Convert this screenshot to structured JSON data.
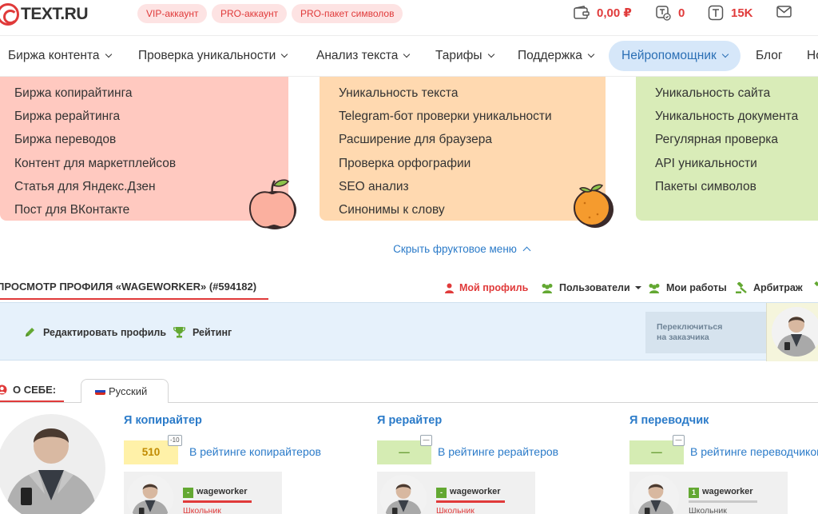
{
  "header": {
    "logo_text": "TEXT.RU",
    "pills": [
      "VIP-аккаунт",
      "PRO-аккаунт",
      "PRO-пакет символов"
    ],
    "balance": "0,00 ₽",
    "tasks_count": "0",
    "symbols": "15K"
  },
  "nav": {
    "items": [
      {
        "label": "Биржа контента"
      },
      {
        "label": "Проверка уникальности"
      },
      {
        "label": "Анализ текста"
      },
      {
        "label": "Тарифы"
      },
      {
        "label": "Поддержка"
      },
      {
        "label": "Нейропомощник"
      },
      {
        "label": "Блог"
      },
      {
        "label": "Но"
      }
    ]
  },
  "fruit_menu": {
    "red": [
      "Биржа копирайтинга",
      "Биржа рерайтинга",
      "Биржа переводов",
      "Контент для маркетплейсов",
      "Статья для Яндекс.Дзен",
      "Пост для ВКонтакте"
    ],
    "orange": [
      "Уникальность текста",
      "Telegram-бот проверки уникальности",
      "Расширение для браузера",
      "Проверка орфографии",
      "SEO анализ",
      "Синонимы к слову"
    ],
    "green": [
      "Уникальность сайта",
      "Уникальность документа",
      "Регулярная проверка",
      "API уникальности",
      "Пакеты символов"
    ],
    "hide_label": "Скрыть фруктовое меню"
  },
  "profile": {
    "title": "ПРОСМОТР ПРОФИЛЯ «WAGEWORKER» (#594182)",
    "tabs": {
      "my_profile": "Мой профиль",
      "users": "Пользователи",
      "my_works": "Мои работы",
      "arbitrage": "Арбитраж"
    },
    "actions": {
      "edit": "Редактировать профиль",
      "rating": "Рейтинг",
      "switch_line1": "Переключиться",
      "switch_line2": "на заказчика"
    },
    "about_label": "О СЕБЕ:",
    "language_tab": "Русский"
  },
  "roles": [
    {
      "title": "Я копирайтер",
      "score": "510",
      "badge": "-10",
      "link": "В рейтинге копирайтеров",
      "username": "wageworker",
      "level": "-",
      "rank": "Школьник"
    },
    {
      "title": "Я рерайтер",
      "score": "—",
      "badge": "—",
      "link": "В рейтинге рерайтеров",
      "username": "wageworker",
      "level": "-",
      "rank": "Школьник"
    },
    {
      "title": "Я переводчик",
      "score": "—",
      "badge": "—",
      "link": "В рейтинге переводчиков",
      "username": "wageworker",
      "level": "1",
      "rank": "Школьник"
    }
  ],
  "colors": {
    "brand_red": "#e03a3a",
    "link_blue": "#2b7bc9",
    "red_panel": "#ffc9c0",
    "orange_panel": "#ffd9b0",
    "green_panel": "#d9ecb8"
  }
}
